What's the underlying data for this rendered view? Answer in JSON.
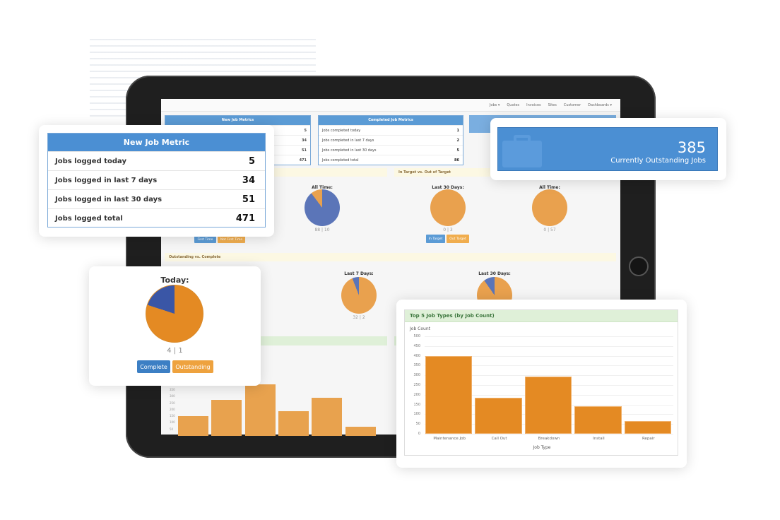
{
  "colors": {
    "blue": "#5b75b8",
    "orange": "#e9a14e",
    "panel_blue": "#5b9bd5",
    "bar": "#e48a23"
  },
  "nav": [
    "Jobs ▾",
    "Quotes",
    "Invoices",
    "Sites",
    "Customer",
    "Dashboards ▾"
  ],
  "screen": {
    "new_metrics": {
      "title": "New Job Metrics",
      "values": [
        "5",
        "34",
        "51",
        "471"
      ]
    },
    "completed_metrics": {
      "title": "Completed Job Metrics",
      "rows": [
        {
          "label": "Jobs completed today",
          "value": "1"
        },
        {
          "label": "Jobs completed in last 7 days",
          "value": "2"
        },
        {
          "label": "Jobs completed in last 30 days",
          "value": "5"
        },
        {
          "label": "Jobs completed total",
          "value": "86"
        }
      ]
    },
    "in_target_header": "In Target vs. Out of Target",
    "outstanding_header": "Outstanding vs. Complete",
    "pies": [
      {
        "label": "All Time:",
        "count": "88 | 10",
        "a": 88,
        "b": 10,
        "a_color": "blue",
        "b_color": "orange"
      },
      {
        "label": "Last 30 Days:",
        "count": "0 | 3",
        "a": 0,
        "b": 3,
        "a_color": "blue",
        "b_color": "orange"
      },
      {
        "label": "All Time:",
        "count": "0 | 57",
        "a": 0,
        "b": 57,
        "a_color": "blue",
        "b_color": "orange"
      },
      {
        "label": "Last 7 Days:",
        "count": "32 | 2",
        "a": 32,
        "b": 2,
        "a_color": "orange",
        "b_color": "blue"
      },
      {
        "label": "Last 30 Days:",
        "a": 28,
        "b": 3,
        "a_color": "orange",
        "b_color": "blue"
      }
    ],
    "first_time_buttons": [
      "First Time",
      "Not First Time"
    ],
    "target_buttons": [
      "In Target",
      "Out Target"
    ],
    "bg_chart": {
      "ticks": [
        "350",
        "300",
        "250",
        "200",
        "150",
        "100",
        "50"
      ],
      "values": [
        150,
        275,
        390,
        190,
        290,
        70
      ]
    }
  },
  "new_job_card": {
    "title": "New Job Metric",
    "rows": [
      {
        "label": "Jobs logged today",
        "value": "5"
      },
      {
        "label": "Jobs logged in last 7 days",
        "value": "34"
      },
      {
        "label": "Jobs logged in last 30 days",
        "value": "51"
      },
      {
        "label": "Jobs logged total",
        "value": "471"
      }
    ]
  },
  "outstanding_card": {
    "value": "385",
    "label": "Currently Outstanding Jobs",
    "icon": "briefcase-icon"
  },
  "today_card": {
    "title": "Today:",
    "count": "4 | 1",
    "outstanding": 4,
    "complete": 1,
    "buttons": [
      "Complete",
      "Outstanding"
    ]
  },
  "chart_data": {
    "type": "bar",
    "title": "Top 5 Job Types (by Job Count)",
    "xlabel": "Job Type",
    "ylabel": "Job Count",
    "categories": [
      "Maintenance Job",
      "Call Out",
      "Breakdown",
      "Install",
      "Repair"
    ],
    "values": [
      400,
      185,
      295,
      140,
      65
    ],
    "ylim": [
      0,
      500
    ],
    "yticks": [
      "0",
      "50",
      "100",
      "150",
      "200",
      "250",
      "300",
      "350",
      "400",
      "450",
      "500"
    ],
    "grid": true
  }
}
